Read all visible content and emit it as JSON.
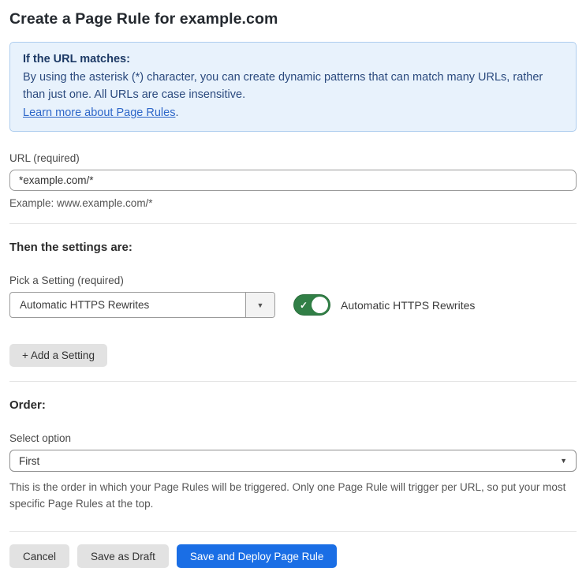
{
  "page": {
    "title": "Create a Page Rule for example.com"
  },
  "info_box": {
    "heading": "If the URL matches:",
    "body": "By using the asterisk (*) character, you can create dynamic patterns that can match many URLs, rather than just one. All URLs are case insensitive.",
    "link_label": "Learn more about Page Rules",
    "link_suffix": "."
  },
  "url_field": {
    "label": "URL (required)",
    "value": "*example.com/*",
    "hint": "Example: www.example.com/*"
  },
  "settings_section": {
    "heading": "Then the settings are:",
    "pick_label": "Pick a Setting (required)",
    "selected_setting": "Automatic HTTPS Rewrites",
    "toggle_label": "Automatic HTTPS Rewrites",
    "toggle_state": "on",
    "add_button_label": "+ Add a Setting"
  },
  "order_section": {
    "heading": "Order:",
    "select_label": "Select option",
    "selected_option": "First",
    "help_text": "This is the order in which your Page Rules will be triggered. Only one Page Rule will trigger per URL, so put your most specific Page Rules at the top."
  },
  "footer": {
    "cancel_label": "Cancel",
    "save_draft_label": "Save as Draft",
    "save_deploy_label": "Save and Deploy Page Rule"
  },
  "colors": {
    "accent_blue": "#1a6ee5",
    "info_bg": "#e8f2fc",
    "info_border": "#aecdee",
    "info_heading_text": "#1d3a66",
    "info_body_text": "#2b4a7e",
    "link_blue": "#2e67c9",
    "toggle_green": "#317f46"
  },
  "icons": {
    "dropdown_caret": "▼",
    "select_caret": "▼",
    "toggle_check": "✓"
  }
}
